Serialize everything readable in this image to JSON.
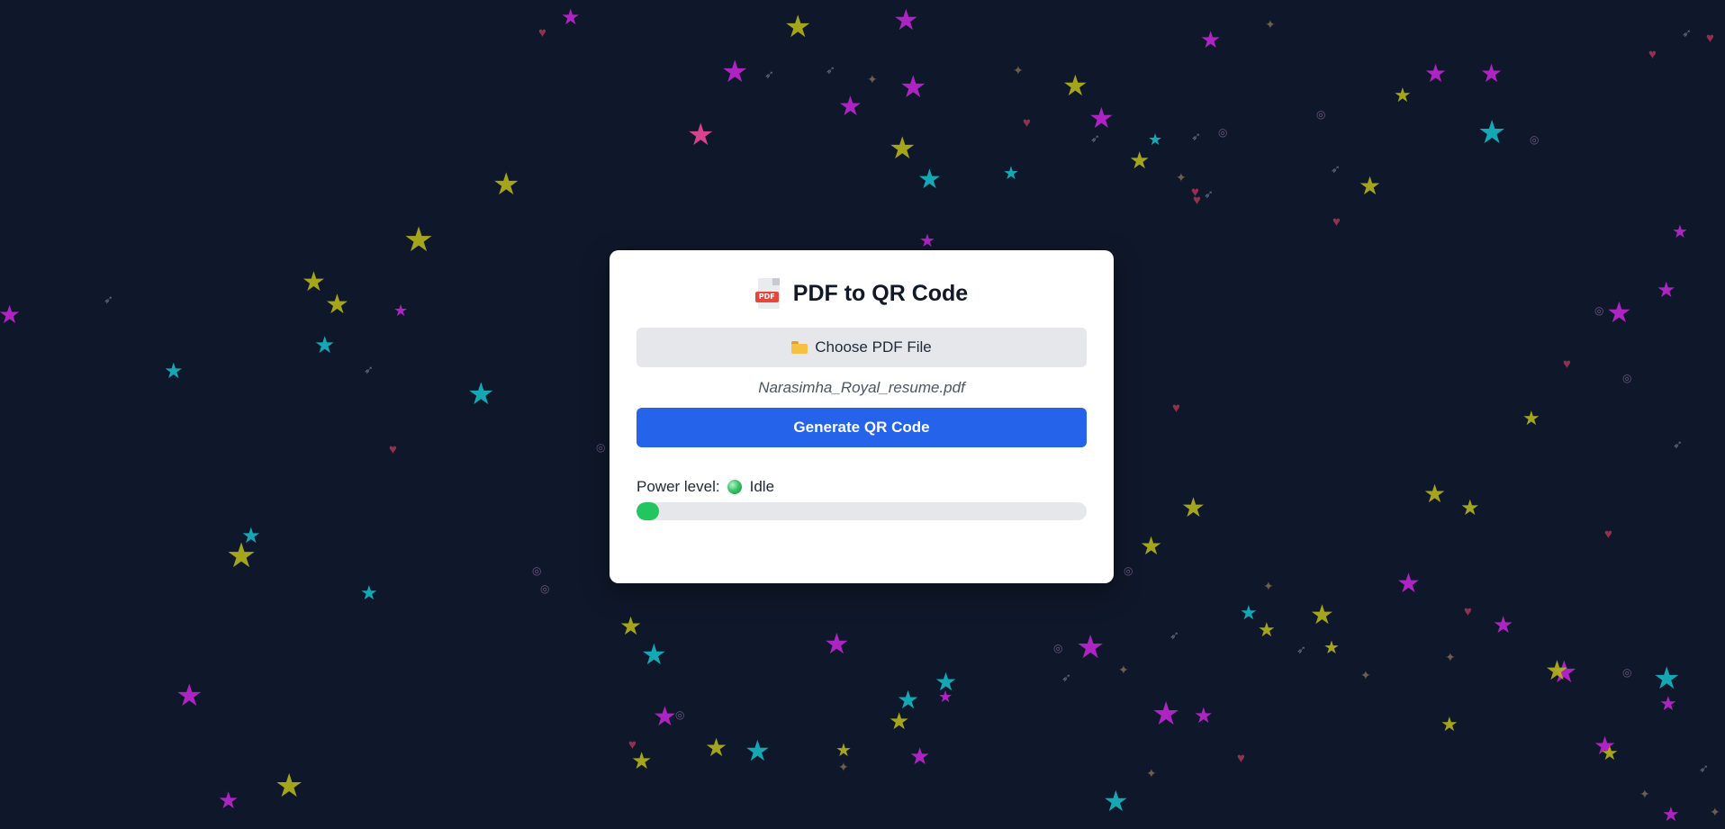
{
  "app": {
    "title": "PDF to QR Code",
    "choose_button_label": "Choose PDF File",
    "selected_file_name": "Narasimha_Royal_resume.pdf",
    "generate_button_label": "Generate QR Code",
    "power_label": "Power level:",
    "power_status": "Idle",
    "power_level_fraction": 0.05,
    "pdf_badge_text": "PDF"
  },
  "icons": {
    "header": "pdf-file-icon",
    "choose_button": "folder-icon",
    "power_status": "green-orb-icon"
  },
  "colors": {
    "background": "#0f172a",
    "card": "#ffffff",
    "primary_button": "#2563eb",
    "secondary_button": "#e5e7eb",
    "progress_fill": "#22c55e",
    "star_magenta": "#c026d3",
    "star_yellow": "#b5b51a",
    "star_cyan": "#14b8c4",
    "star_pink": "#ec4899"
  }
}
